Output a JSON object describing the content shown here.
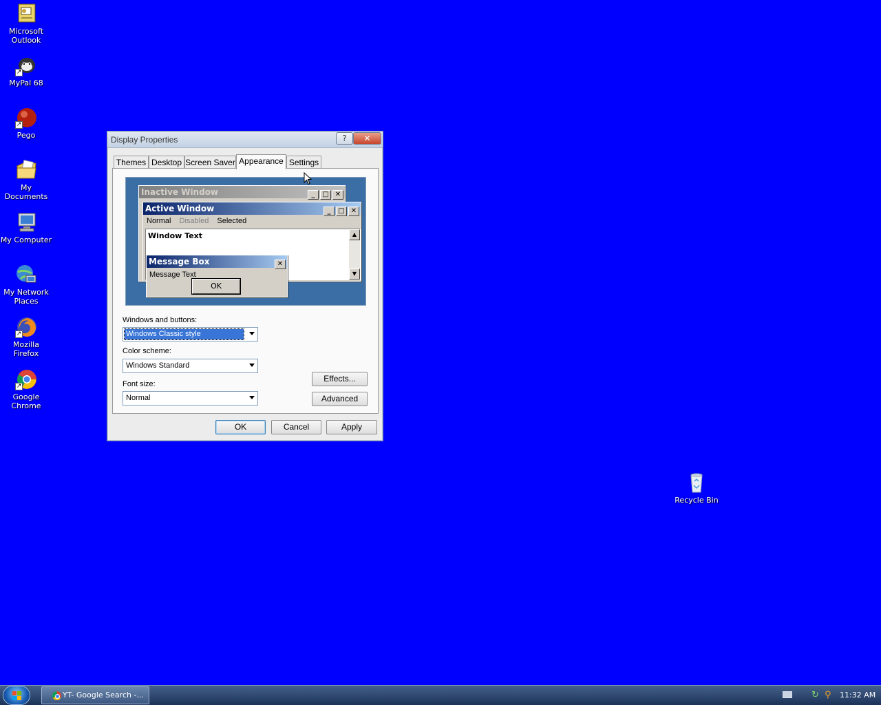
{
  "desktop": {
    "icons": [
      {
        "label": "Microsoft Outlook",
        "icon": "outlook-icon"
      },
      {
        "label": "MyPal 68",
        "icon": "mypal-icon"
      },
      {
        "label": "Pego",
        "icon": "pego-icon"
      },
      {
        "label": "My Documents",
        "icon": "my-documents-icon"
      },
      {
        "label": "My Computer",
        "icon": "my-computer-icon"
      },
      {
        "label": "My Network Places",
        "icon": "network-icon"
      },
      {
        "label": "Mozilla Firefox",
        "icon": "firefox-icon"
      },
      {
        "label": "Google Chrome",
        "icon": "chrome-icon"
      }
    ],
    "recycle_bin": {
      "label": "Recycle Bin",
      "icon": "recycle-bin-icon"
    },
    "background_color": "#0000ff"
  },
  "dialog": {
    "title": "Display Properties",
    "help_glyph": "?",
    "close_glyph": "✕",
    "tabs": [
      {
        "label": "Themes"
      },
      {
        "label": "Desktop"
      },
      {
        "label": "Screen Saver"
      },
      {
        "label": "Appearance",
        "active": true
      },
      {
        "label": "Settings"
      }
    ],
    "preview": {
      "inactive_title": "Inactive Window",
      "active_title": "Active Window",
      "menu_normal": "Normal",
      "menu_disabled": "Disabled",
      "menu_selected": "Selected",
      "window_text": "Window Text",
      "msgbox_title": "Message Box",
      "msgbox_text": "Message Text",
      "msgbox_ok": "OK"
    },
    "windows_buttons": {
      "label": "Windows and buttons:",
      "value": "Windows Classic style"
    },
    "color_scheme": {
      "label": "Color scheme:",
      "value": "Windows Standard"
    },
    "font_size": {
      "label": "Font size:",
      "value": "Normal"
    },
    "effects_button": "Effects...",
    "advanced_button": "Advanced",
    "ok_button": "OK",
    "cancel_button": "Cancel",
    "apply_button": "Apply"
  },
  "taskbar": {
    "task_label": "YT- Google Search -...",
    "clock": "11:32 AM"
  }
}
